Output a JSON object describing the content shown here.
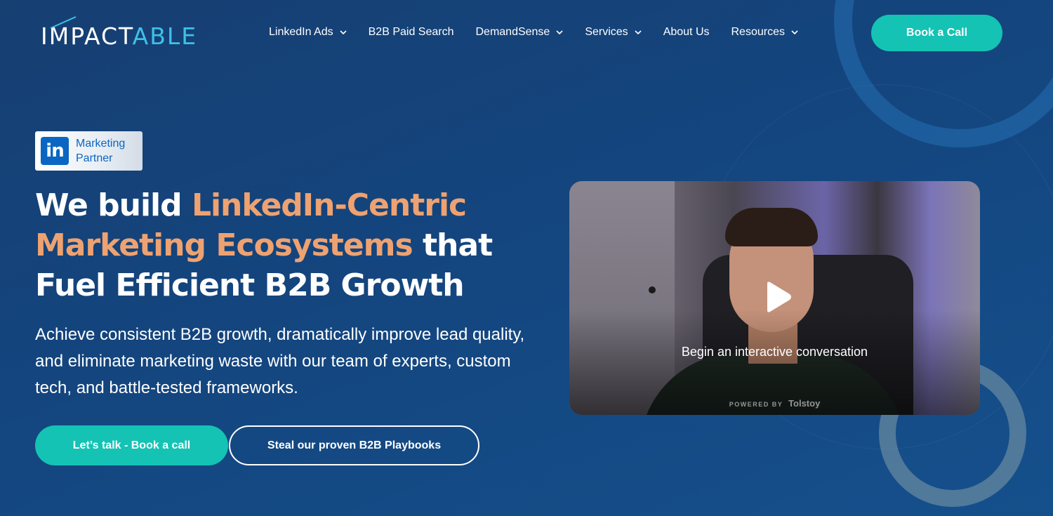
{
  "brand": {
    "logo_part1": "IMPACT",
    "logo_part2": "ABLE"
  },
  "nav": {
    "items": [
      {
        "label": "LinkedIn Ads",
        "has_dropdown": true
      },
      {
        "label": "B2B Paid Search",
        "has_dropdown": false
      },
      {
        "label": "DemandSense",
        "has_dropdown": true
      },
      {
        "label": "Services",
        "has_dropdown": true
      },
      {
        "label": "About Us",
        "has_dropdown": false
      },
      {
        "label": "Resources",
        "has_dropdown": true
      }
    ],
    "cta": "Book a Call"
  },
  "badge": {
    "icon": "linkedin-icon",
    "line1": "Marketing",
    "line2": "Partner"
  },
  "hero": {
    "headline_part1": "We build ",
    "headline_accent": "LinkedIn-Centric Marketing Ecosystems",
    "headline_part2": " that Fuel Efficient B2B Growth",
    "subheadline": "Achieve consistent B2B growth, dramatically improve lead quality, and eliminate marketing waste with our team of experts, custom tech, and battle-tested frameworks.",
    "primary_button": "Let’s talk - Book a call",
    "secondary_button": "Steal our proven B2B Playbooks"
  },
  "video": {
    "caption": "Begin an interactive conversation",
    "powered_by": "POWERED BY",
    "powered_brand": "Tolstoy"
  },
  "colors": {
    "accent_teal": "#14c3b4",
    "accent_orange": "#eea271",
    "background": "#15457e",
    "logo_blue": "#3ec1e6"
  }
}
